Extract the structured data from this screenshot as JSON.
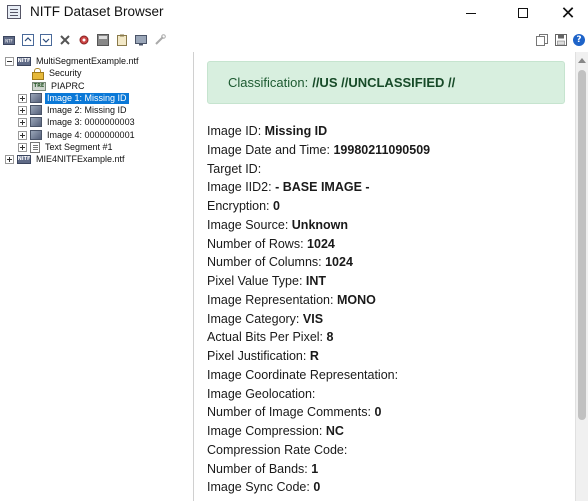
{
  "window": {
    "title": "NITF Dataset Browser",
    "minimize": "",
    "maximize": "",
    "close": "✕"
  },
  "toolbar": {
    "left_icons": [
      "open-file-icon",
      "collapse-icon",
      "expand-icon",
      "delete-icon",
      "settings-icon",
      "export-icon",
      "clipboard-icon",
      "image-view-icon",
      "tools-icon"
    ],
    "right_icons": [
      "copy-icon",
      "save-icon",
      "help-icon"
    ],
    "help_glyph": "?"
  },
  "tree": {
    "root1": "MultiSegmentExample.ntf",
    "security": "Security",
    "piaprc": "PIAPRC",
    "image1": "Image 1: Missing ID",
    "image2": "Image 2: Missing ID",
    "image3": "Image 3: 0000000003",
    "image4": "Image 4: 0000000001",
    "text1": "Text Segment #1",
    "root2": "MIE4NITFExample.ntf",
    "ntf_badge": "NITF",
    "tre_badge": "TRE"
  },
  "details": {
    "classification_label": "Classification:",
    "classification_value": "//US //UNCLASSIFIED //",
    "fields": [
      {
        "label": "Image ID:",
        "value": "Missing ID"
      },
      {
        "label": "Image Date and Time:",
        "value": "19980211090509"
      },
      {
        "label": "Target ID:",
        "value": ""
      },
      {
        "label": "Image IID2:",
        "value": "- BASE IMAGE -"
      },
      {
        "label": "Encryption:",
        "value": "0"
      },
      {
        "label": "Image Source:",
        "value": "Unknown"
      },
      {
        "label": "Number of Rows:",
        "value": "1024"
      },
      {
        "label": "Number of Columns:",
        "value": "1024"
      },
      {
        "label": "Pixel Value Type:",
        "value": "INT"
      },
      {
        "label": "Image Representation:",
        "value": "MONO"
      },
      {
        "label": "Image Category:",
        "value": "VIS"
      },
      {
        "label": "Actual Bits Per Pixel:",
        "value": "8"
      },
      {
        "label": "Pixel Justification:",
        "value": "R"
      },
      {
        "label": "Image Coordinate Representation:",
        "value": ""
      },
      {
        "label": "Image Geolocation:",
        "value": ""
      },
      {
        "label": "Number of Image Comments:",
        "value": "0"
      },
      {
        "label": "Image Compression:",
        "value": "NC"
      },
      {
        "label": "Compression Rate Code:",
        "value": ""
      },
      {
        "label": "Number of Bands:",
        "value": "1"
      },
      {
        "label": "Image Sync Code:",
        "value": "0"
      }
    ]
  },
  "colors": {
    "selection": "#0a78d7",
    "classification_bg": "#d8efdf",
    "classification_text": "#1d5a31"
  }
}
